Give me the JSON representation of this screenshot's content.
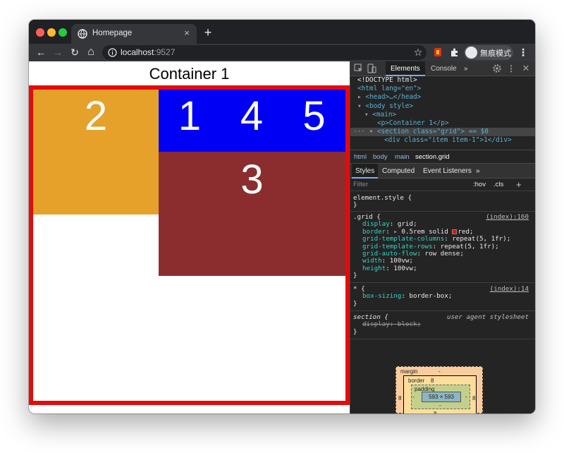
{
  "browser": {
    "tab_title": "Homepage",
    "tab_close": "×",
    "new_tab": "+",
    "url_host": "localhost",
    "url_port": ":9527",
    "profile_label": "無痕模式",
    "back": "←",
    "forward": "→",
    "reload": "↻",
    "home": "⌂",
    "star": "☆",
    "menu": "⋮"
  },
  "page": {
    "heading": "Container 1",
    "items": {
      "item2": "2",
      "item1": "1",
      "item4": "4",
      "item5": "5",
      "item3": "3"
    },
    "colors": {
      "border": "#e30b0b",
      "orange": "#e6a12b",
      "blue": "#0000f5",
      "maroon": "#8b2d2f"
    }
  },
  "devtools": {
    "tabs": {
      "elements": "Elements",
      "console": "Console",
      "more": "»"
    },
    "dom": [
      "<!DOCTYPE html>",
      "<html lang=\"en\">",
      "<head>…</head>",
      "<body style>",
      "<main>",
      "<p>Container 1</p>",
      "<section class=\"grid\"> == $0",
      "<div class=\"item item-1\">1</div>"
    ],
    "breadcrumbs": [
      "html",
      "body",
      "main",
      "section.grid"
    ],
    "styles_tabs": {
      "styles": "Styles",
      "computed": "Computed",
      "events": "Event Listeners",
      "more": "»"
    },
    "filter_placeholder": "Filter",
    "hov": ":hov",
    "cls": ".cls",
    "plus": "+",
    "rules": {
      "element_style": {
        "selector": "element.style {",
        "close": "}"
      },
      "grid": {
        "selector": ".grid {",
        "source": "(index):160",
        "props": [
          {
            "name": "display",
            "value": "grid;"
          },
          {
            "name": "border",
            "value": "0.5rem solid",
            "value2": "red;"
          },
          {
            "name": "grid-template-columns",
            "value": "repeat(5, 1fr);"
          },
          {
            "name": "grid-template-rows",
            "value": "repeat(5, 1fr);"
          },
          {
            "name": "grid-auto-flow",
            "value": "row dense;"
          },
          {
            "name": "width",
            "value": "100vw;"
          },
          {
            "name": "height",
            "value": "100vw;"
          }
        ],
        "close": "}"
      },
      "universal": {
        "selector": "* {",
        "source": "(index):14",
        "prop_name": "box-sizing",
        "prop_value": "border-box;",
        "close": "}"
      },
      "section": {
        "selector": "section {",
        "source": "user agent stylesheet",
        "prop": "display: block;",
        "close": "}"
      }
    },
    "box_model": {
      "margin_label": "margin",
      "margin_value": "-",
      "border_label": "border",
      "border_value": "8",
      "padding_label": "padding",
      "padding_value": "-",
      "content": "593 × 593"
    }
  }
}
